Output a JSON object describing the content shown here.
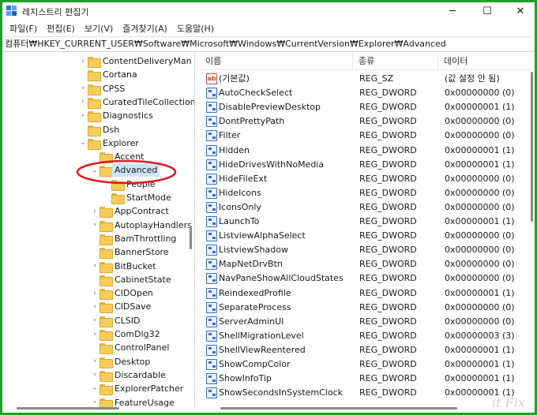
{
  "window": {
    "title": "레지스트리 편집기",
    "controls": {
      "minimize": "─",
      "maximize": "☐",
      "close": "✕"
    }
  },
  "menu": [
    "파일(F)",
    "편집(E)",
    "보기(V)",
    "즐겨찾기(A)",
    "도움말(H)"
  ],
  "address": "컴퓨터₩HKEY_CURRENT_USER₩Software₩Microsoft₩Windows₩CurrentVersion₩Explorer₩Advanced",
  "tree": [
    {
      "label": "ContentDeliveryMan",
      "expander": "›",
      "level": 0
    },
    {
      "label": "Cortana",
      "expander": "",
      "level": 0
    },
    {
      "label": "CPSS",
      "expander": "›",
      "level": 0
    },
    {
      "label": "CuratedTileCollection",
      "expander": "›",
      "level": 0
    },
    {
      "label": "Diagnostics",
      "expander": "›",
      "level": 0
    },
    {
      "label": "Dsh",
      "expander": "",
      "level": 0
    },
    {
      "label": "Explorer",
      "expander": "⌄",
      "level": 0
    },
    {
      "label": "Accent",
      "expander": "",
      "level": 1
    },
    {
      "label": "Advanced",
      "expander": "⌄",
      "level": 1,
      "selected": true
    },
    {
      "label": "People",
      "expander": "",
      "level": 2
    },
    {
      "label": "StartMode",
      "expander": "",
      "level": 2
    },
    {
      "label": "AppContract",
      "expander": "›",
      "level": 1
    },
    {
      "label": "AutoplayHandlers",
      "expander": "›",
      "level": 1
    },
    {
      "label": "BamThrottling",
      "expander": "",
      "level": 1
    },
    {
      "label": "BannerStore",
      "expander": "",
      "level": 1
    },
    {
      "label": "BitBucket",
      "expander": "›",
      "level": 1
    },
    {
      "label": "CabinetState",
      "expander": "",
      "level": 1
    },
    {
      "label": "CIDOpen",
      "expander": "›",
      "level": 1
    },
    {
      "label": "CIDSave",
      "expander": "›",
      "level": 1
    },
    {
      "label": "CLSID",
      "expander": "›",
      "level": 1
    },
    {
      "label": "ComDlg32",
      "expander": "›",
      "level": 1
    },
    {
      "label": "ControlPanel",
      "expander": "",
      "level": 1
    },
    {
      "label": "Desktop",
      "expander": "›",
      "level": 1
    },
    {
      "label": "Discardable",
      "expander": "›",
      "level": 1
    },
    {
      "label": "ExplorerPatcher",
      "expander": "›",
      "level": 1
    },
    {
      "label": "FeatureUsage",
      "expander": "›",
      "level": 1
    }
  ],
  "columns": {
    "name": "이름",
    "type": "종류",
    "data": "데이터"
  },
  "values": [
    {
      "name": "(기본값)",
      "type": "REG_SZ",
      "data": "(값 설정 안 됨)",
      "icon": "string-value-icon"
    },
    {
      "name": "AutoCheckSelect",
      "type": "REG_DWORD",
      "data": "0x00000000 (0)",
      "icon": "dword-value-icon"
    },
    {
      "name": "DisablePreviewDesktop",
      "type": "REG_DWORD",
      "data": "0x00000001 (1)",
      "icon": "dword-value-icon"
    },
    {
      "name": "DontPrettyPath",
      "type": "REG_DWORD",
      "data": "0x00000000 (0)",
      "icon": "dword-value-icon"
    },
    {
      "name": "Filter",
      "type": "REG_DWORD",
      "data": "0x00000000 (0)",
      "icon": "dword-value-icon"
    },
    {
      "name": "Hidden",
      "type": "REG_DWORD",
      "data": "0x00000001 (1)",
      "icon": "dword-value-icon"
    },
    {
      "name": "HideDrivesWithNoMedia",
      "type": "REG_DWORD",
      "data": "0x00000001 (1)",
      "icon": "dword-value-icon"
    },
    {
      "name": "HideFileExt",
      "type": "REG_DWORD",
      "data": "0x00000000 (0)",
      "icon": "dword-value-icon"
    },
    {
      "name": "HideIcons",
      "type": "REG_DWORD",
      "data": "0x00000000 (0)",
      "icon": "dword-value-icon"
    },
    {
      "name": "IconsOnly",
      "type": "REG_DWORD",
      "data": "0x00000000 (0)",
      "icon": "dword-value-icon"
    },
    {
      "name": "LaunchTo",
      "type": "REG_DWORD",
      "data": "0x00000001 (1)",
      "icon": "dword-value-icon"
    },
    {
      "name": "ListviewAlphaSelect",
      "type": "REG_DWORD",
      "data": "0x00000000 (0)",
      "icon": "dword-value-icon"
    },
    {
      "name": "ListviewShadow",
      "type": "REG_DWORD",
      "data": "0x00000000 (0)",
      "icon": "dword-value-icon"
    },
    {
      "name": "MapNetDrvBtn",
      "type": "REG_DWORD",
      "data": "0x00000000 (0)",
      "icon": "dword-value-icon"
    },
    {
      "name": "NavPaneShowAllCloudStates",
      "type": "REG_DWORD",
      "data": "0x00000000 (0)",
      "icon": "dword-value-icon"
    },
    {
      "name": "ReindexedProfile",
      "type": "REG_DWORD",
      "data": "0x00000001 (1)",
      "icon": "dword-value-icon"
    },
    {
      "name": "SeparateProcess",
      "type": "REG_DWORD",
      "data": "0x00000000 (0)",
      "icon": "dword-value-icon"
    },
    {
      "name": "ServerAdminUI",
      "type": "REG_DWORD",
      "data": "0x00000000 (0)",
      "icon": "dword-value-icon"
    },
    {
      "name": "ShellMigrationLevel",
      "type": "REG_DWORD",
      "data": "0x00000003 (3)",
      "icon": "dword-value-icon"
    },
    {
      "name": "ShellViewReentered",
      "type": "REG_DWORD",
      "data": "0x00000001 (1)",
      "icon": "dword-value-icon"
    },
    {
      "name": "ShowCompColor",
      "type": "REG_DWORD",
      "data": "0x00000001 (1)",
      "icon": "dword-value-icon"
    },
    {
      "name": "ShowInfoTip",
      "type": "REG_DWORD",
      "data": "0x00000001 (1)",
      "icon": "dword-value-icon"
    },
    {
      "name": "ShowSecondsInSystemClock",
      "type": "REG_DWORD",
      "data": "0x00000001 (1)",
      "icon": "dword-value-icon"
    }
  ],
  "watermark": "it Fix",
  "colors": {
    "frame": "#1e9e2a",
    "selection": "#cce4f7",
    "highlight_ellipse": "#e0191e",
    "dword_icon": "#3a6fc4",
    "string_icon": "#c44a3a"
  }
}
